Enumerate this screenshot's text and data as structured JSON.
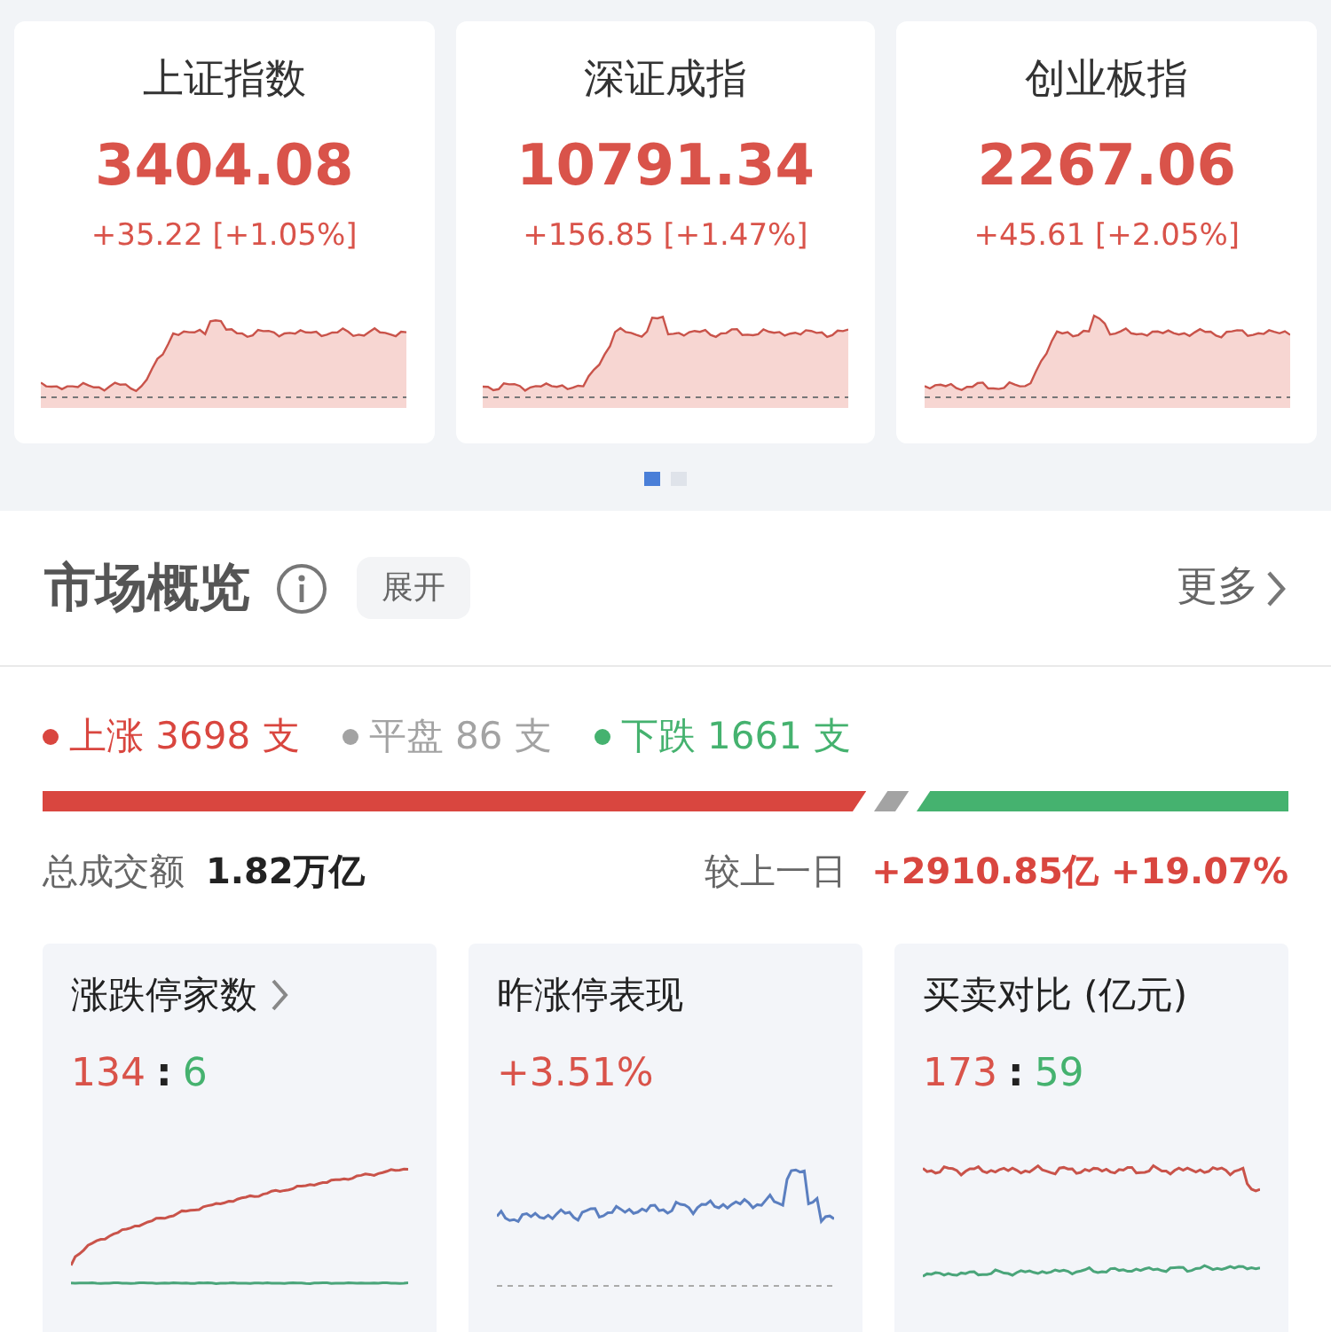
{
  "indices": [
    {
      "name": "上证指数",
      "value": "3404.08",
      "change": "+35.22 [+1.05%]"
    },
    {
      "name": "深证成指",
      "value": "10791.34",
      "change": "+156.85 [+1.47%]"
    },
    {
      "name": "创业板指",
      "value": "2267.06",
      "change": "+45.61 [+2.05%]"
    }
  ],
  "pager": [
    {
      "selected": true
    },
    {
      "selected": false
    }
  ],
  "overview": {
    "title": "市场概览",
    "expand_label": "展开",
    "more_label": "更多"
  },
  "breadth": [
    {
      "label": "上涨 3698 支",
      "color": "#d9463f"
    },
    {
      "label": "平盘 86 支",
      "color": "#a3a3a3"
    },
    {
      "label": "下跌 1661 支",
      "color": "#45b26f"
    }
  ],
  "turnover": {
    "label": "总成交额",
    "value": "1.82万亿",
    "compare_label": "较上一日",
    "compare_value": "+2910.85亿 +19.07%"
  },
  "cards": [
    {
      "title": "涨跌停家数",
      "link": true,
      "kind": "ratio",
      "up": "134",
      "sep": ":",
      "down": "6"
    },
    {
      "title": "昨涨停表现",
      "link": false,
      "kind": "change",
      "value": "+3.51%"
    },
    {
      "title": "买卖对比 (亿元)",
      "link": false,
      "kind": "ratio",
      "up": "173",
      "sep": ":",
      "down": "59"
    }
  ]
}
